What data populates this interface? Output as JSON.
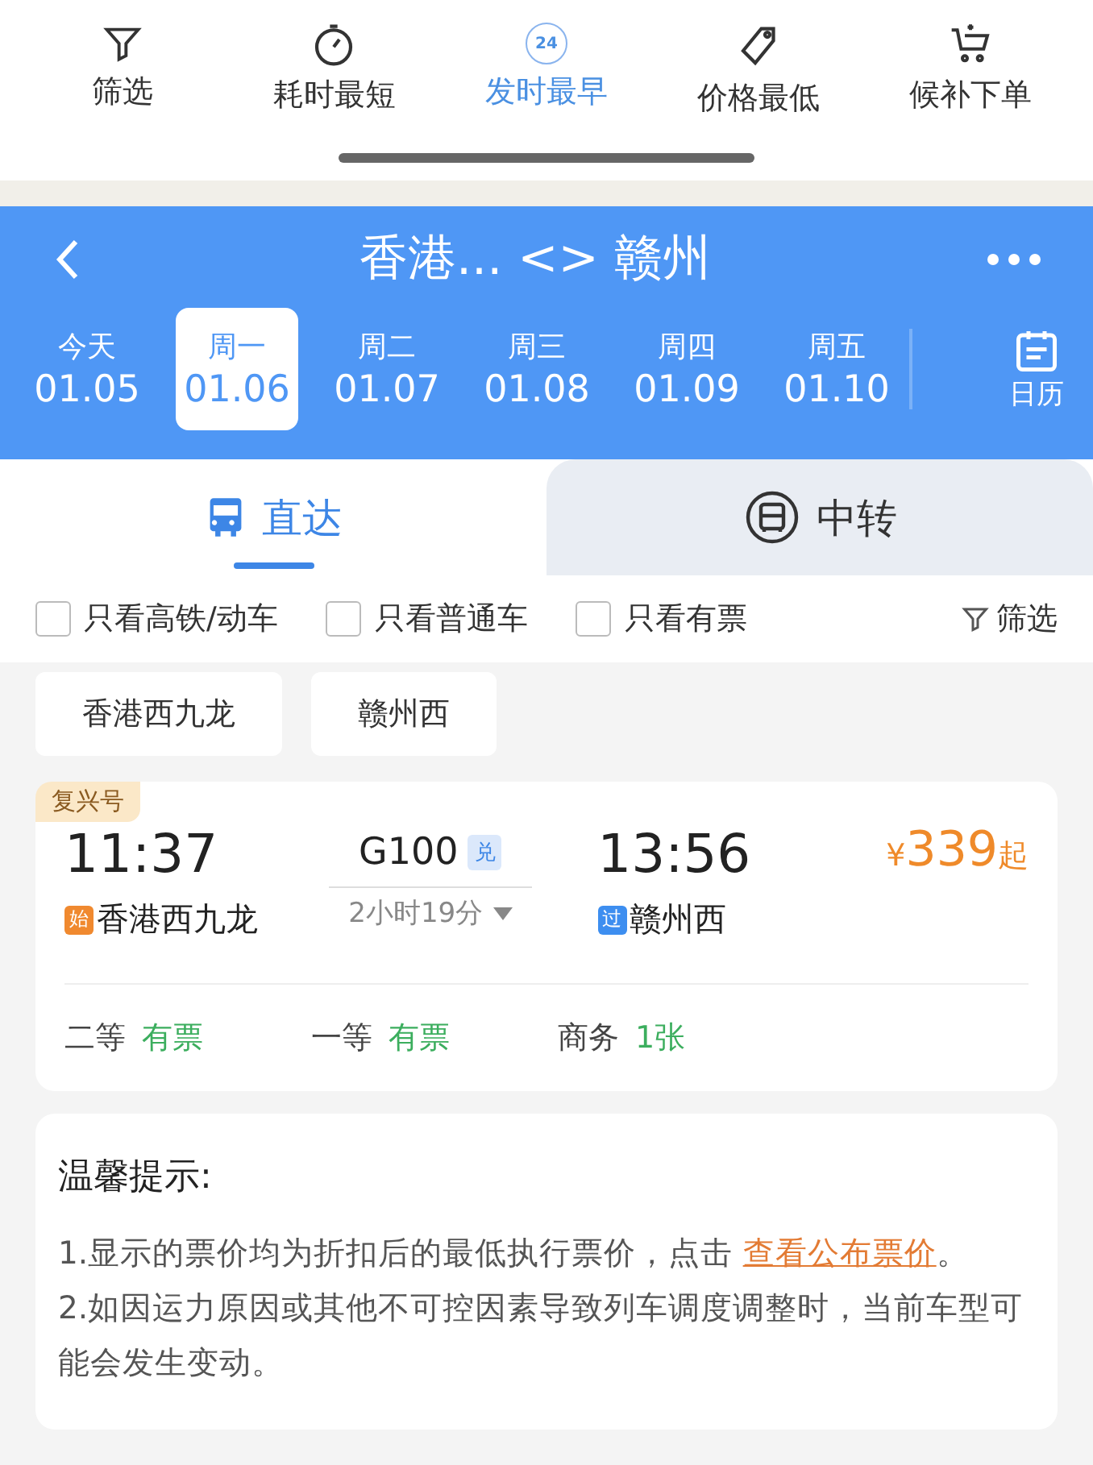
{
  "sort_bar": [
    {
      "kind": "filter",
      "label": "筛选",
      "selected": false
    },
    {
      "kind": "clock",
      "label": "耗时最短",
      "selected": false
    },
    {
      "kind": "badge",
      "badge": "24",
      "label": "发时最早",
      "selected": true
    },
    {
      "kind": "tag",
      "label": "价格最低",
      "selected": false
    },
    {
      "kind": "cart",
      "label": "候补下单",
      "selected": false
    }
  ],
  "header": {
    "title": "香港... <> 赣州"
  },
  "dates": [
    {
      "weekday": "今天",
      "date": "01.05",
      "selected": false
    },
    {
      "weekday": "周一",
      "date": "01.06",
      "selected": true
    },
    {
      "weekday": "周二",
      "date": "01.07",
      "selected": false
    },
    {
      "weekday": "周三",
      "date": "01.08",
      "selected": false
    },
    {
      "weekday": "周四",
      "date": "01.09",
      "selected": false
    },
    {
      "weekday": "周五",
      "date": "01.10",
      "selected": false
    }
  ],
  "calendar_label": "日历",
  "tabs": [
    {
      "kind": "direct",
      "label": "直达",
      "selected": true
    },
    {
      "kind": "transfer",
      "label": "中转",
      "selected": false
    }
  ],
  "filters": [
    {
      "label": "只看高铁/动车",
      "checked": false
    },
    {
      "label": "只看普通车",
      "checked": false
    },
    {
      "label": "只看有票",
      "checked": false
    }
  ],
  "filter_button": "筛选",
  "stations": [
    "香港西九龙",
    "赣州西"
  ],
  "train": {
    "type_tag": "复兴号",
    "depart_time": "11:37",
    "number": "G100",
    "number_badge": "兑",
    "arrive_time": "13:56",
    "price_symbol": "¥",
    "price": "339",
    "price_suffix": "起",
    "duration": "2小时19分",
    "stops": [
      {
        "badge": "始",
        "color": "#f0892f",
        "name": "香港西九龙"
      },
      {
        "badge": "过",
        "color": "#3d8ef0",
        "name": "赣州西"
      }
    ],
    "seats": [
      {
        "class": "二等",
        "availability": "有票"
      },
      {
        "class": "一等",
        "availability": "有票"
      },
      {
        "class": "商务",
        "availability": "1张"
      }
    ]
  },
  "notice": {
    "title": "温馨提示:",
    "items": [
      {
        "text": "1.显示的票价均为折扣后的最低执行票价，点击 ",
        "link": "查看公布票价",
        "after": "。"
      },
      {
        "text": "2.如因运力原因或其他不可控因素导致列车调度调整时，当前车型可能会发生变动。"
      }
    ]
  }
}
